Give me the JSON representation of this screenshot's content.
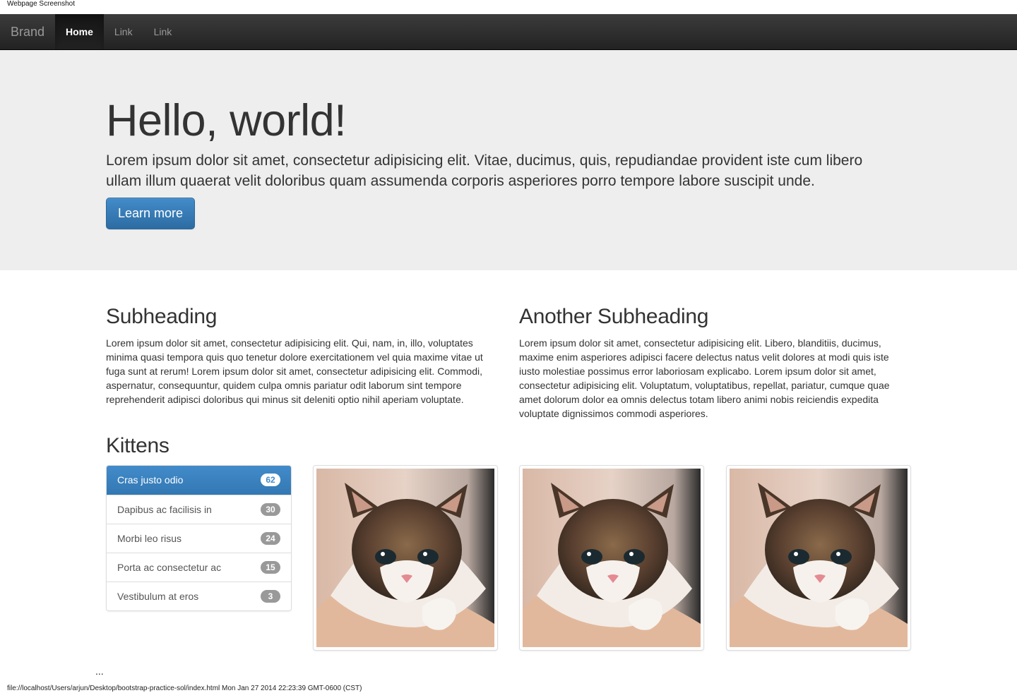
{
  "page_caption": "Webpage Screenshot",
  "navbar": {
    "brand": "Brand",
    "links": [
      {
        "label": "Home",
        "active": true
      },
      {
        "label": "Link",
        "active": false
      },
      {
        "label": "Link",
        "active": false
      }
    ]
  },
  "jumbotron": {
    "title": "Hello, world!",
    "text": "Lorem ipsum dolor sit amet, consectetur adipisicing elit. Vitae, ducimus, quis, repudiandae provident iste cum libero ullam illum quaerat velit doloribus quam assumenda corporis asperiores porro tempore labore suscipit unde.",
    "button_label": "Learn more"
  },
  "sections": [
    {
      "heading": "Subheading",
      "body": "Lorem ipsum dolor sit amet, consectetur adipisicing elit. Qui, nam, in, illo, voluptates minima quasi tempora quis quo tenetur dolore exercitationem vel quia maxime vitae ut fuga sunt at rerum! Lorem ipsum dolor sit amet, consectetur adipisicing elit. Commodi, aspernatur, consequuntur, quidem culpa omnis pariatur odit laborum sint tempore reprehenderit adipisci doloribus qui minus sit deleniti optio nihil aperiam voluptate."
    },
    {
      "heading": "Another Subheading",
      "body": "Lorem ipsum dolor sit amet, consectetur adipisicing elit. Libero, blanditiis, ducimus, maxime enim asperiores adipisci facere delectus natus velit dolores at modi quis iste iusto molestiae possimus error laboriosam explicabo. Lorem ipsum dolor sit amet, consectetur adipisicing elit. Voluptatum, voluptatibus, repellat, pariatur, cumque quae amet dolorum dolor ea omnis delectus totam libero animi nobis reiciendis expedita voluptate dignissimos commodi asperiores."
    }
  ],
  "kittens": {
    "heading": "Kittens",
    "list": [
      {
        "label": "Cras justo odio",
        "badge": "62",
        "active": true
      },
      {
        "label": "Dapibus ac facilisis in",
        "badge": "30",
        "active": false
      },
      {
        "label": "Morbi leo risus",
        "badge": "24",
        "active": false
      },
      {
        "label": "Porta ac consectetur ac",
        "badge": "15",
        "active": false
      },
      {
        "label": "Vestibulum at eros",
        "badge": "3",
        "active": false
      }
    ],
    "thumbnails": [
      "kitten-photo",
      "kitten-photo",
      "kitten-photo"
    ]
  },
  "ellipsis": "...",
  "footer_url": "file://localhost/Users/arjun/Desktop/bootstrap-practice-sol/index.html Mon Jan 27 2014 22:23:39 GMT-0600 (CST)",
  "colors": {
    "navbar": "#222222",
    "jumbotron": "#eeeeee",
    "primary": "#428bca",
    "badge": "#999999"
  }
}
